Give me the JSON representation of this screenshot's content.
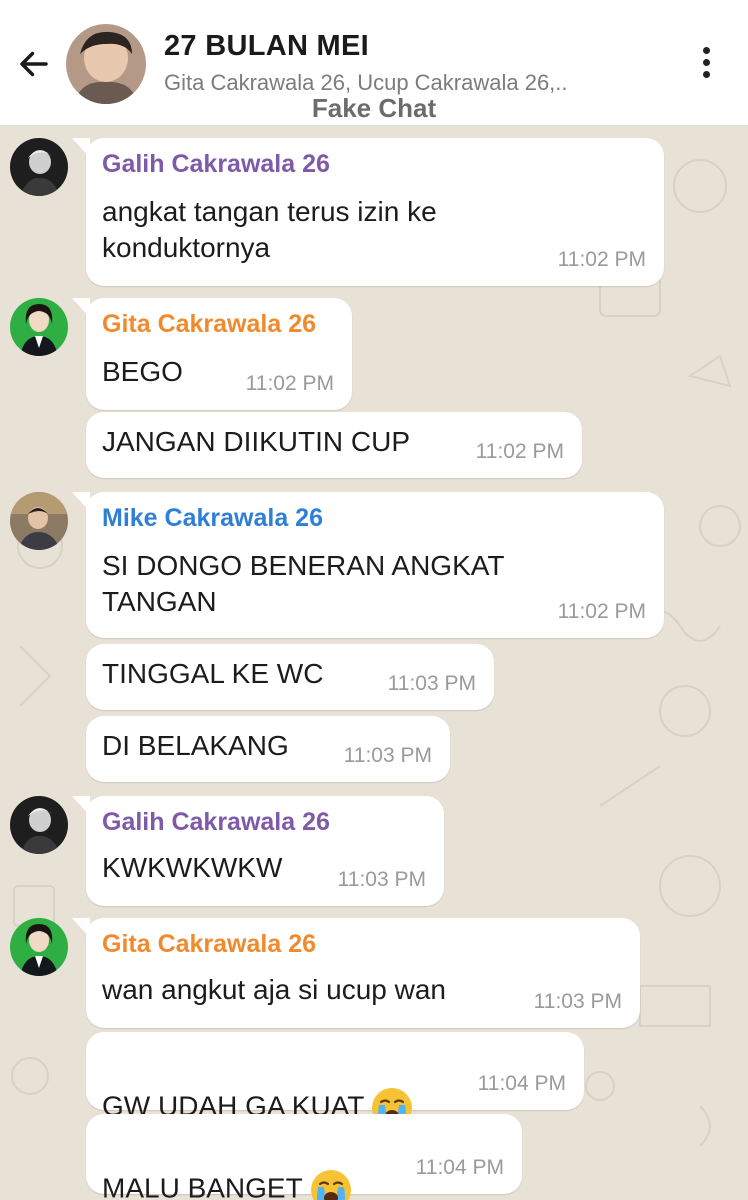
{
  "header": {
    "title": "27 BULAN MEI",
    "subtitle": "Gita Cakrawala 26, Ucup Cakrawala 26,..",
    "watermark": "Fake Chat",
    "back_icon": "arrow-left-icon",
    "more_icon": "more-vertical-icon"
  },
  "colors": {
    "galih": "#7f5aa8",
    "gita": "#f08a2c",
    "mike": "#2f7fd6",
    "background": "#e8e1d6",
    "bubble": "#ffffff"
  },
  "messages": [
    {
      "sender": "Galih Cakrawala 26",
      "text": "angkat tangan terus izin ke\nkonduktornya",
      "time": "11:02 PM"
    },
    {
      "sender": "Gita Cakrawala 26",
      "text": "BEGO",
      "time": "11:02 PM"
    },
    {
      "text": "JANGAN DIIKUTIN CUP",
      "time": "11:02 PM"
    },
    {
      "sender": "Mike Cakrawala 26",
      "text": "SI DONGO BENERAN ANGKAT\nTANGAN",
      "time": "11:02 PM"
    },
    {
      "text": "TINGGAL KE WC",
      "time": "11:03 PM"
    },
    {
      "text": "DI BELAKANG",
      "time": "11:03 PM"
    },
    {
      "sender": "Galih Cakrawala 26",
      "text": "KWKWKWKW",
      "time": "11:03 PM"
    },
    {
      "sender": "Gita Cakrawala 26",
      "text": "wan angkut aja si ucup wan",
      "time": "11:03 PM"
    },
    {
      "text": "GW UDAH GA KUAT",
      "time": "11:04 PM",
      "emoji": "loudly-crying-face-icon"
    },
    {
      "text": "MALU BANGET",
      "time": "11:04 PM",
      "emoji": "loudly-crying-face-icon"
    }
  ]
}
